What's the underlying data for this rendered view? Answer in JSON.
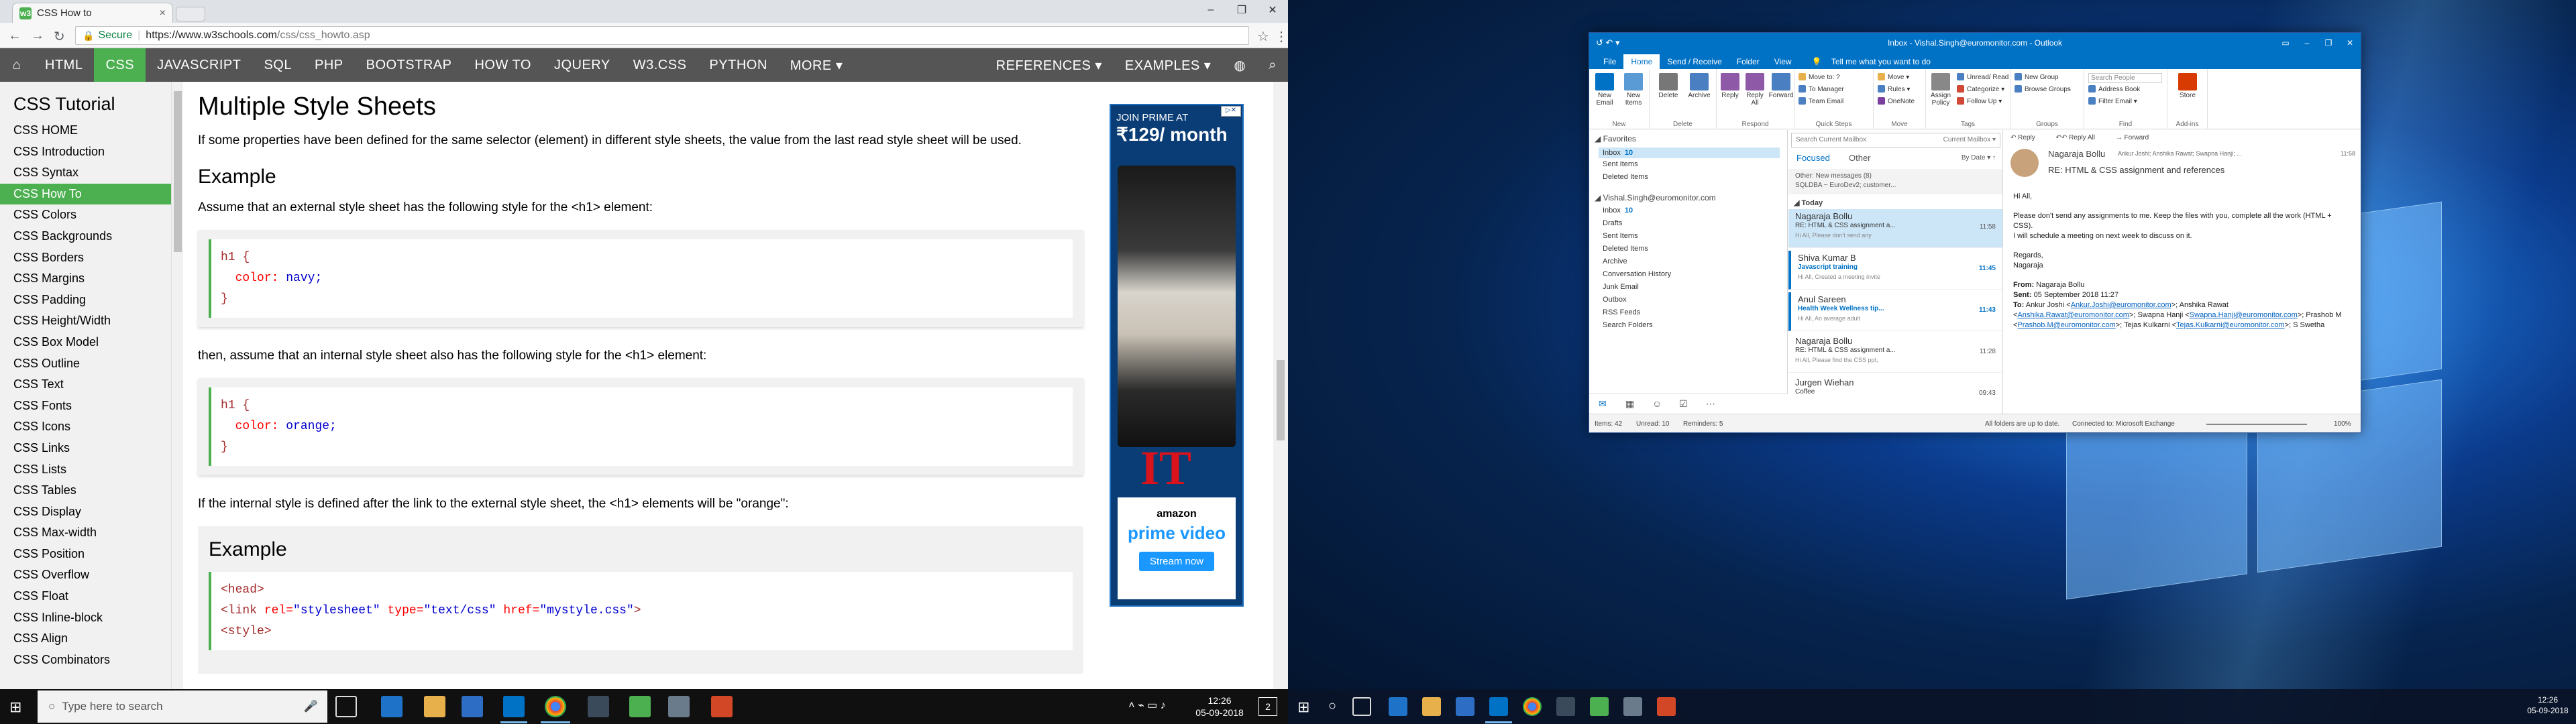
{
  "browser": {
    "tab_title": "CSS How to",
    "tab_favicon": "w3",
    "secure_label": "Secure",
    "url_host": "https://www.w3schools.com",
    "url_path": "/css/css_howto.asp"
  },
  "w3nav": {
    "items": [
      "HTML",
      "CSS",
      "JAVASCRIPT",
      "SQL",
      "PHP",
      "BOOTSTRAP",
      "HOW TO",
      "JQUERY",
      "W3.CSS",
      "PYTHON",
      "MORE ▾"
    ],
    "right_items": [
      "REFERENCES ▾",
      "EXAMPLES ▾"
    ]
  },
  "sidebar": {
    "title": "CSS Tutorial",
    "links": [
      "CSS HOME",
      "CSS Introduction",
      "CSS Syntax",
      "CSS How To",
      "CSS Colors",
      "CSS Backgrounds",
      "CSS Borders",
      "CSS Margins",
      "CSS Padding",
      "CSS Height/Width",
      "CSS Box Model",
      "CSS Outline",
      "CSS Text",
      "CSS Fonts",
      "CSS Icons",
      "CSS Links",
      "CSS Lists",
      "CSS Tables",
      "CSS Display",
      "CSS Max-width",
      "CSS Position",
      "CSS Overflow",
      "CSS Float",
      "CSS Inline-block",
      "CSS Align",
      "CSS Combinators"
    ],
    "active_index": 3
  },
  "content": {
    "heading": "Multiple Style Sheets",
    "intro": "If some properties have been defined for the same selector (element) in different style sheets, the value from the last read style sheet will be used.",
    "example_heading": "Example",
    "p_external": "Assume that an external style sheet has the following style for the <h1> element:",
    "code1": {
      "sel": "h1 {",
      "prop": "color:",
      "val": "navy;",
      "close": "}"
    },
    "p_internal": "then, assume that an internal style sheet also has the following style for the <h1> element:",
    "code2": {
      "sel": "h1 {",
      "prop": "color:",
      "val": "orange;",
      "close": "}"
    },
    "p_result": "If the internal style is defined after the link to the external style sheet, the <h1> elements will be \"orange\":",
    "example2_heading": "Example",
    "code3": {
      "l1": "<head>",
      "l2_tag": "<link",
      "l2_a1": "rel=",
      "l2_v1": "\"stylesheet\"",
      "l2_a2": "type=",
      "l2_v2": "\"text/css\"",
      "l2_a3": "href=",
      "l2_v3": "\"mystyle.css\"",
      "l2_end": ">",
      "l3": "<style>"
    }
  },
  "ad": {
    "line1": "JOIN PRIME AT",
    "price": "₹129/ month",
    "brand1": "amazon",
    "brand2": "prime video",
    "cta": "Stream now"
  },
  "taskbar_left": {
    "search_placeholder": "Type here to search",
    "time": "12:26",
    "date": "05-09-2018",
    "notif_count": "2"
  },
  "outlook": {
    "title": "Inbox - Vishal.Singh@euromonitor.com - Outlook",
    "tabs": [
      "File",
      "Home",
      "Send / Receive",
      "Folder",
      "View"
    ],
    "active_tab": "Home",
    "tell_me": "Tell me what you want to do",
    "ribbon": {
      "new_email": "New Email",
      "new_items": "New Items",
      "group_new": "New",
      "delete": "Delete",
      "archive": "Archive",
      "group_delete": "Delete",
      "reply": "Reply",
      "reply_all": "Reply All",
      "forward": "Forward",
      "group_respond": "Respond",
      "qs_move_to": "Move to: ?",
      "qs_to_manager": "To Manager",
      "qs_team_email": "Team Email",
      "group_quicksteps": "Quick Steps",
      "move": "Move ▾",
      "rules": "Rules ▾",
      "onenote": "OneNote",
      "group_move": "Move",
      "assign_policy": "Assign Policy",
      "unread_read": "Unread/ Read",
      "categorize": "Categorize ▾",
      "follow_up": "Follow Up ▾",
      "group_tags": "Tags",
      "new_group": "New Group",
      "browse_groups": "Browse Groups",
      "group_groups": "Groups",
      "search_people": "Search People",
      "address_book": "Address Book",
      "filter_email": "Filter Email ▾",
      "group_find": "Find",
      "store": "Store",
      "group_addins": "Add-ins"
    },
    "favorites": {
      "header": "◢ Favorites",
      "items": [
        {
          "name": "Inbox",
          "count": "10"
        },
        {
          "name": "Sent Items",
          "count": ""
        },
        {
          "name": "Deleted Items",
          "count": ""
        }
      ]
    },
    "account": {
      "header": "◢ Vishal.Singh@euromonitor.com",
      "items": [
        {
          "name": "Inbox",
          "count": "10"
        },
        {
          "name": "Drafts",
          "count": ""
        },
        {
          "name": "Sent Items",
          "count": ""
        },
        {
          "name": "Deleted Items",
          "count": ""
        },
        {
          "name": "Archive",
          "count": ""
        },
        {
          "name": "Conversation History",
          "count": ""
        },
        {
          "name": "Junk Email",
          "count": ""
        },
        {
          "name": "Outbox",
          "count": ""
        },
        {
          "name": "RSS Feeds",
          "count": ""
        },
        {
          "name": "Search Folders",
          "count": ""
        }
      ]
    },
    "list": {
      "search_placeholder": "Search Current Mailbox",
      "scope": "Current Mailbox ▾",
      "focused": "Focused",
      "other": "Other",
      "sort": "By Date ▾   ↑",
      "other_msg_1": "Other: New messages (8)",
      "other_msg_2": "SQLDBA ~ EuroDev2; customer...",
      "today": "◢ Today",
      "mails": [
        {
          "from": "Nagaraja Bollu",
          "subject": "RE: HTML & CSS assignment a...",
          "preview": "Hi All,  Please don't send any",
          "time": "11:58",
          "selected": true,
          "unread": false
        },
        {
          "from": "Shiva Kumar B",
          "subject": "Javascript training",
          "preview": "Hi All,  Created a meeting invite",
          "time": "11:45",
          "selected": false,
          "unread": true
        },
        {
          "from": "Anul Sareen",
          "subject": "Health Week   Wellness tip...",
          "preview": "Hi All,  An average adult",
          "time": "11:43",
          "selected": false,
          "unread": true
        },
        {
          "from": "Nagaraja Bollu",
          "subject": "RE: HTML & CSS assignment a...",
          "preview": "Hi All,  Please find the CSS ppt,",
          "time": "11:28",
          "selected": false,
          "unread": false
        },
        {
          "from": "Jurgen Wiehan",
          "subject": "Coffee",
          "preview": "",
          "time": "09:43",
          "selected": false,
          "unread": false
        }
      ]
    },
    "reading": {
      "reply": "Reply",
      "reply_all": "Reply All",
      "forward": "Forward",
      "sender": "Nagaraja Bollu",
      "recipients": "Ankur Joshi; Anshika Rawat; Swapna Hanji; ...",
      "time": "11:58",
      "subject": "RE: HTML & CSS assignment and references",
      "greeting": "Hi All,",
      "body1": "Please don't send any assignments to me. Keep the files with you, complete all the work (HTML + CSS).",
      "body2": "I will schedule a meeting on next week to discuss on it.",
      "regards": "Regards,",
      "sign": "Nagaraja",
      "from_label": "From:",
      "from_val": "Nagaraja Bollu",
      "sent_label": "Sent:",
      "sent_val": "05 September 2018 11:27",
      "to_label": "To:",
      "to_1": "Ankur Joshi <",
      "to_1_link": "Ankur.Joshi@euromonitor.com",
      "to_2": ">; Anshika Rawat <",
      "to_2_link": "Anshika.Rawat@euromonitor.com",
      "to_3": ">; Swapna Hanji <",
      "to_3_link": "Swapna.Hanji@euromonitor.com",
      "to_4": ">; Prashob M <",
      "to_4_link": "Prashob.M@euromonitor.com",
      "to_5": ">; Tejas Kulkarni <",
      "to_5_link": "Tejas.Kulkarni@euromonitor.com",
      "to_6": ">; S Swetha"
    },
    "status": {
      "items": "Items: 42",
      "unread": "Unread: 10",
      "reminders": "Reminders: 5",
      "uptodate": "All folders are up to date.",
      "connected": "Connected to: Microsoft Exchange",
      "zoom": "100%"
    }
  },
  "taskbar_right": {
    "time": "12:26",
    "date": "05-09-2018"
  }
}
